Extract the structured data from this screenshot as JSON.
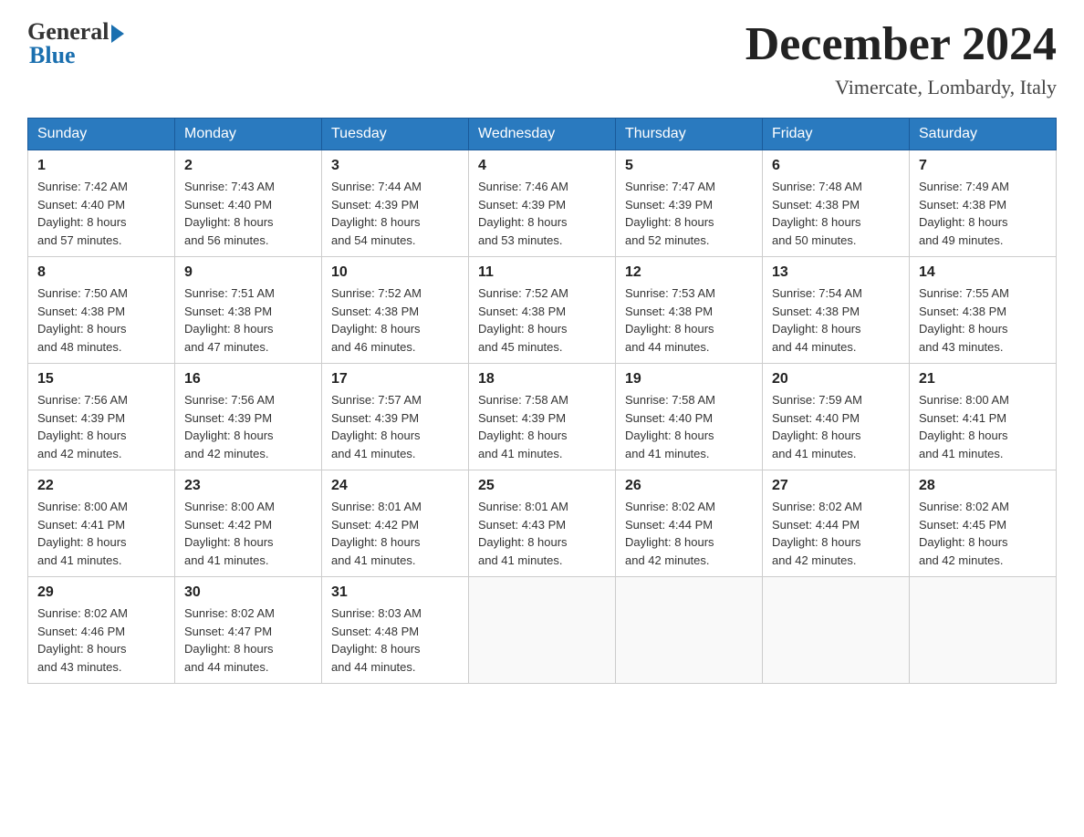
{
  "header": {
    "logo_general": "General",
    "logo_blue": "Blue",
    "month_title": "December 2024",
    "location": "Vimercate, Lombardy, Italy"
  },
  "days_of_week": [
    "Sunday",
    "Monday",
    "Tuesday",
    "Wednesday",
    "Thursday",
    "Friday",
    "Saturday"
  ],
  "weeks": [
    [
      {
        "day": "1",
        "sunrise": "7:42 AM",
        "sunset": "4:40 PM",
        "daylight": "8 hours and 57 minutes."
      },
      {
        "day": "2",
        "sunrise": "7:43 AM",
        "sunset": "4:40 PM",
        "daylight": "8 hours and 56 minutes."
      },
      {
        "day": "3",
        "sunrise": "7:44 AM",
        "sunset": "4:39 PM",
        "daylight": "8 hours and 54 minutes."
      },
      {
        "day": "4",
        "sunrise": "7:46 AM",
        "sunset": "4:39 PM",
        "daylight": "8 hours and 53 minutes."
      },
      {
        "day": "5",
        "sunrise": "7:47 AM",
        "sunset": "4:39 PM",
        "daylight": "8 hours and 52 minutes."
      },
      {
        "day": "6",
        "sunrise": "7:48 AM",
        "sunset": "4:38 PM",
        "daylight": "8 hours and 50 minutes."
      },
      {
        "day": "7",
        "sunrise": "7:49 AM",
        "sunset": "4:38 PM",
        "daylight": "8 hours and 49 minutes."
      }
    ],
    [
      {
        "day": "8",
        "sunrise": "7:50 AM",
        "sunset": "4:38 PM",
        "daylight": "8 hours and 48 minutes."
      },
      {
        "day": "9",
        "sunrise": "7:51 AM",
        "sunset": "4:38 PM",
        "daylight": "8 hours and 47 minutes."
      },
      {
        "day": "10",
        "sunrise": "7:52 AM",
        "sunset": "4:38 PM",
        "daylight": "8 hours and 46 minutes."
      },
      {
        "day": "11",
        "sunrise": "7:52 AM",
        "sunset": "4:38 PM",
        "daylight": "8 hours and 45 minutes."
      },
      {
        "day": "12",
        "sunrise": "7:53 AM",
        "sunset": "4:38 PM",
        "daylight": "8 hours and 44 minutes."
      },
      {
        "day": "13",
        "sunrise": "7:54 AM",
        "sunset": "4:38 PM",
        "daylight": "8 hours and 44 minutes."
      },
      {
        "day": "14",
        "sunrise": "7:55 AM",
        "sunset": "4:38 PM",
        "daylight": "8 hours and 43 minutes."
      }
    ],
    [
      {
        "day": "15",
        "sunrise": "7:56 AM",
        "sunset": "4:39 PM",
        "daylight": "8 hours and 42 minutes."
      },
      {
        "day": "16",
        "sunrise": "7:56 AM",
        "sunset": "4:39 PM",
        "daylight": "8 hours and 42 minutes."
      },
      {
        "day": "17",
        "sunrise": "7:57 AM",
        "sunset": "4:39 PM",
        "daylight": "8 hours and 41 minutes."
      },
      {
        "day": "18",
        "sunrise": "7:58 AM",
        "sunset": "4:39 PM",
        "daylight": "8 hours and 41 minutes."
      },
      {
        "day": "19",
        "sunrise": "7:58 AM",
        "sunset": "4:40 PM",
        "daylight": "8 hours and 41 minutes."
      },
      {
        "day": "20",
        "sunrise": "7:59 AM",
        "sunset": "4:40 PM",
        "daylight": "8 hours and 41 minutes."
      },
      {
        "day": "21",
        "sunrise": "8:00 AM",
        "sunset": "4:41 PM",
        "daylight": "8 hours and 41 minutes."
      }
    ],
    [
      {
        "day": "22",
        "sunrise": "8:00 AM",
        "sunset": "4:41 PM",
        "daylight": "8 hours and 41 minutes."
      },
      {
        "day": "23",
        "sunrise": "8:00 AM",
        "sunset": "4:42 PM",
        "daylight": "8 hours and 41 minutes."
      },
      {
        "day": "24",
        "sunrise": "8:01 AM",
        "sunset": "4:42 PM",
        "daylight": "8 hours and 41 minutes."
      },
      {
        "day": "25",
        "sunrise": "8:01 AM",
        "sunset": "4:43 PM",
        "daylight": "8 hours and 41 minutes."
      },
      {
        "day": "26",
        "sunrise": "8:02 AM",
        "sunset": "4:44 PM",
        "daylight": "8 hours and 42 minutes."
      },
      {
        "day": "27",
        "sunrise": "8:02 AM",
        "sunset": "4:44 PM",
        "daylight": "8 hours and 42 minutes."
      },
      {
        "day": "28",
        "sunrise": "8:02 AM",
        "sunset": "4:45 PM",
        "daylight": "8 hours and 42 minutes."
      }
    ],
    [
      {
        "day": "29",
        "sunrise": "8:02 AM",
        "sunset": "4:46 PM",
        "daylight": "8 hours and 43 minutes."
      },
      {
        "day": "30",
        "sunrise": "8:02 AM",
        "sunset": "4:47 PM",
        "daylight": "8 hours and 44 minutes."
      },
      {
        "day": "31",
        "sunrise": "8:03 AM",
        "sunset": "4:48 PM",
        "daylight": "8 hours and 44 minutes."
      },
      null,
      null,
      null,
      null
    ]
  ],
  "labels": {
    "sunrise": "Sunrise:",
    "sunset": "Sunset:",
    "daylight": "Daylight:"
  }
}
